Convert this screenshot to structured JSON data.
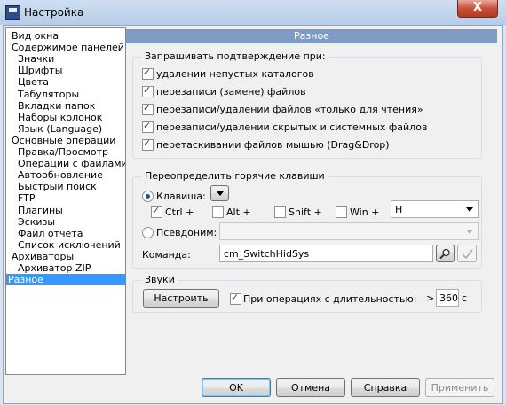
{
  "window": {
    "title": "Настройка",
    "close_glyph": "X"
  },
  "tree": {
    "items": [
      {
        "label": "Вид окна",
        "level": 0
      },
      {
        "label": "Содержимое панелей",
        "level": 0
      },
      {
        "label": "Значки",
        "level": 1
      },
      {
        "label": "Шрифты",
        "level": 1
      },
      {
        "label": "Цвета",
        "level": 1
      },
      {
        "label": "Табуляторы",
        "level": 1
      },
      {
        "label": "Вкладки папок",
        "level": 1
      },
      {
        "label": "Наборы колонок",
        "level": 1
      },
      {
        "label": "Язык (Language)",
        "level": 1
      },
      {
        "label": "Основные операции",
        "level": 0
      },
      {
        "label": "Правка/Просмотр",
        "level": 1
      },
      {
        "label": "Операции с файлами",
        "level": 1
      },
      {
        "label": "Автообновление",
        "level": 1
      },
      {
        "label": "Быстрый поиск",
        "level": 1
      },
      {
        "label": "FTP",
        "level": 1
      },
      {
        "label": "Плагины",
        "level": 1
      },
      {
        "label": "Эскизы",
        "level": 1
      },
      {
        "label": "Файл отчёта",
        "level": 1
      },
      {
        "label": "Список исключений",
        "level": 1
      },
      {
        "label": "Архиваторы",
        "level": 0
      },
      {
        "label": "Архиватор ZIP",
        "level": 1
      },
      {
        "label": "Разное",
        "level": 0,
        "selected": true
      }
    ]
  },
  "panel": {
    "header": "Разное",
    "confirm": {
      "title": "Запрашивать подтверждение при:",
      "options": [
        {
          "label": "удалении непустых каталогов",
          "checked": true
        },
        {
          "label": "перезаписи (замене) файлов",
          "checked": true
        },
        {
          "label": "перезаписи/удалении файлов «только для чтения»",
          "checked": true
        },
        {
          "label": "перезаписи/удалении скрытых и системных файлов",
          "checked": true
        },
        {
          "label": "перетаскивании файлов мышью (Drag&Drop)",
          "checked": true
        }
      ]
    },
    "hotkeys": {
      "title": "Переопределить горячие клавиши",
      "key_label": "Клавиша:",
      "ctrl": {
        "label": "Ctrl +",
        "checked": true
      },
      "alt": {
        "label": "Alt +",
        "checked": false
      },
      "shift": {
        "label": "Shift +",
        "checked": false
      },
      "win": {
        "label": "Win +",
        "checked": false
      },
      "key_value": "H",
      "alias_label": "Псевдоним:",
      "alias_value": "",
      "command_label": "Команда:",
      "command_value": "cm_SwitchHidSys"
    },
    "sounds": {
      "title": "Звуки",
      "configure_button": "Настроить",
      "duration_label": "При операциях с длительностью:",
      "duration_checked": true,
      "gt": ">",
      "seconds_value": "360",
      "seconds_unit": "с"
    }
  },
  "footer": {
    "ok": "OK",
    "cancel": "Отмена",
    "help": "Справка",
    "apply": "Применить"
  }
}
